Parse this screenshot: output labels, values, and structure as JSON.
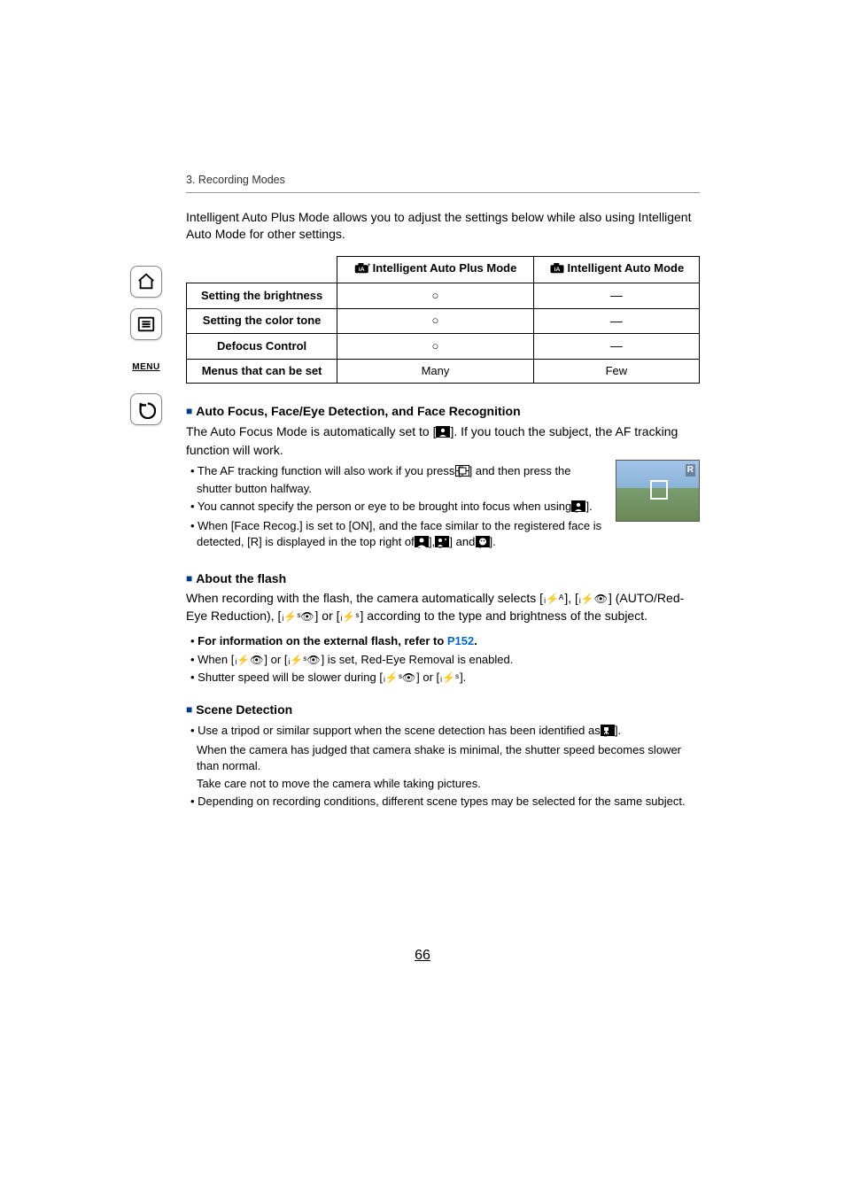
{
  "sidebar": {
    "menu_label": "MENU"
  },
  "breadcrumb": "3. Recording Modes",
  "intro": "Intelligent Auto Plus Mode allows you to adjust the settings below while also using Intelligent Auto Mode for other settings.",
  "table": {
    "col1": "Intelligent Auto Plus Mode",
    "col2": "Intelligent Auto Mode",
    "rows": [
      {
        "label": "Setting the brightness",
        "c1": "○",
        "c2": "—"
      },
      {
        "label": "Setting the color tone",
        "c1": "○",
        "c2": "—"
      },
      {
        "label": "Defocus Control",
        "c1": "○",
        "c2": "—"
      },
      {
        "label": "Menus that can be set",
        "c1": "Many",
        "c2": "Few"
      }
    ]
  },
  "af": {
    "title": "Auto Focus, Face/Eye Detection, and Face Recognition",
    "p1a": "The Auto Focus Mode is automatically set to [",
    "p1b": "]. If you touch the subject, the AF tracking function will work.",
    "b1a": "• The AF tracking function will also work if you press [",
    "b1b": "] and then press the shutter button halfway.",
    "b2a": "• You cannot specify the person or eye to be brought into focus when using [",
    "b2b": "].",
    "b3a": "• When [Face Recog.] is set to [ON], and the face similar to the registered face is detected, [R] is displayed in the top right of [",
    "b3b": "], [",
    "b3c": "] and [",
    "b3d": "]."
  },
  "flash": {
    "title": "About the flash",
    "p1a": "When recording with the flash, the camera automatically selects [",
    "p1b": "], [",
    "p1c": "] (AUTO/Red-Eye Reduction), [",
    "p1d": "] or [",
    "p1e": "] according to the type and brightness of the subject.",
    "b1a_pre": "• ",
    "b1a": "For information on the external flash, refer to ",
    "b1link": "P152",
    "b1b": ".",
    "b2a": "• When [",
    "b2b": "] or [",
    "b2c": "] is set, Red-Eye Removal is enabled.",
    "b3a": "• Shutter speed will be slower during [",
    "b3b": "] or [",
    "b3c": "]."
  },
  "scene": {
    "title": "Scene Detection",
    "b1a": "• Use a tripod or similar support when the scene detection has been identified as [",
    "b1b": "].",
    "b1c": "When the camera has judged that camera shake is minimal, the shutter speed becomes slower than normal.",
    "b1d": "Take care not to move the camera while taking pictures.",
    "b2": "• Depending on recording conditions, different scene types may be selected for the same subject."
  },
  "page_number": "66"
}
